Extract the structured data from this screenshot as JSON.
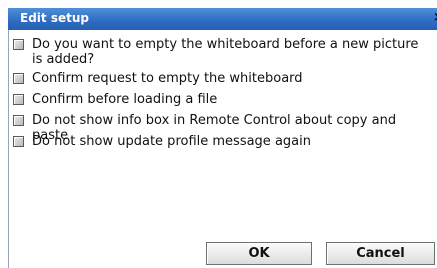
{
  "dialog": {
    "title": "Edit setup",
    "close_glyph": "×",
    "options": [
      {
        "label": "Do you want to empty the whiteboard before a new picture is added?",
        "checked": false
      },
      {
        "label": "Confirm request to empty the whiteboard",
        "checked": false
      },
      {
        "label": "Confirm before loading a file",
        "checked": false
      },
      {
        "label": "Do not show info box in Remote Control about copy and paste",
        "checked": false
      },
      {
        "label": "Do not show update profile message again",
        "checked": false
      }
    ],
    "ok_label": "OK",
    "cancel_label": "Cancel"
  },
  "colors": {
    "titlebar": "#2f6ec4",
    "title_text": "#ffffff",
    "background": "#ffffff"
  }
}
